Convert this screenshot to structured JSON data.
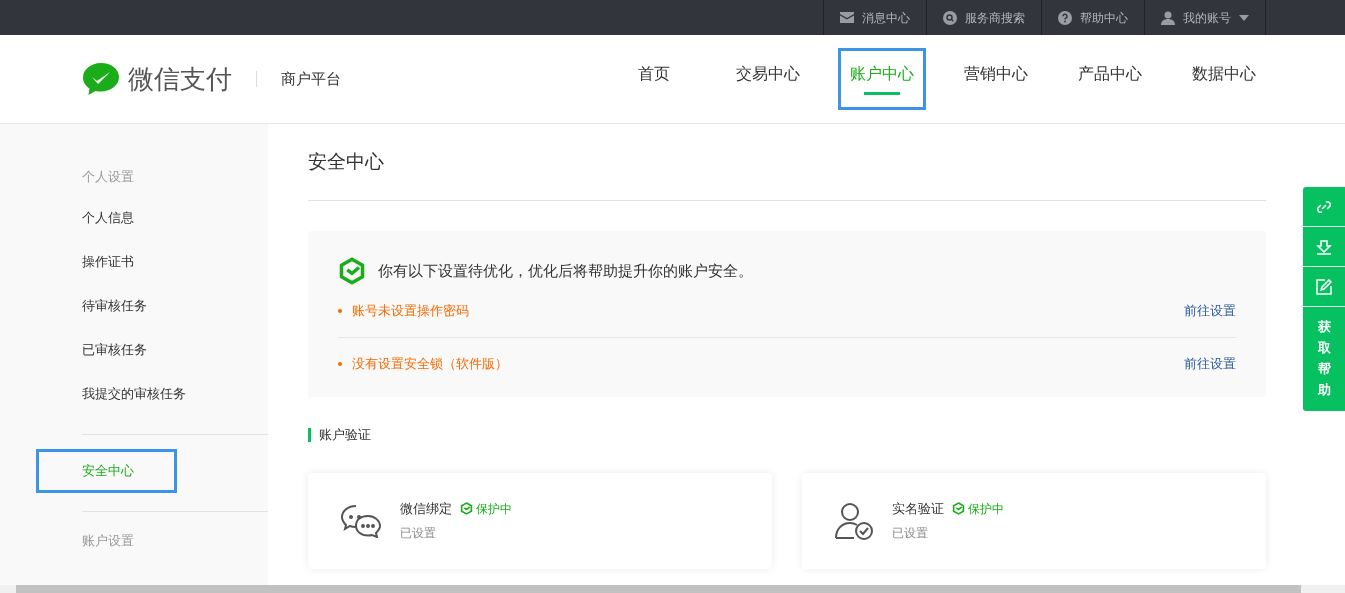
{
  "top_bar": {
    "links": [
      {
        "kind": "mail",
        "label": "消息中心"
      },
      {
        "kind": "search",
        "label": "服务商搜索"
      },
      {
        "kind": "help",
        "label": "帮助中心"
      },
      {
        "kind": "user",
        "label": "我的账号",
        "dropdown": true
      }
    ]
  },
  "header": {
    "brand": "微信支付",
    "subtitle": "商户平台",
    "nav": [
      {
        "label": "首页",
        "selected": false,
        "highlighted": false
      },
      {
        "label": "交易中心",
        "selected": false,
        "highlighted": false
      },
      {
        "label": "账户中心",
        "selected": true,
        "highlighted": true
      },
      {
        "label": "营销中心",
        "selected": false,
        "highlighted": false
      },
      {
        "label": "产品中心",
        "selected": false,
        "highlighted": false
      },
      {
        "label": "数据中心",
        "selected": false,
        "highlighted": false
      }
    ]
  },
  "sidebar": {
    "groups": [
      {
        "title": "个人设置",
        "items": [
          {
            "label": "个人信息",
            "selected": false,
            "highlighted": false
          },
          {
            "label": "操作证书",
            "selected": false,
            "highlighted": false
          },
          {
            "label": "待审核任务",
            "selected": false,
            "highlighted": false
          },
          {
            "label": "已审核任务",
            "selected": false,
            "highlighted": false
          },
          {
            "label": "我提交的审核任务",
            "selected": false,
            "highlighted": false
          }
        ]
      },
      {
        "items": [
          {
            "label": "安全中心",
            "selected": true,
            "highlighted": true
          }
        ]
      },
      {
        "title": "账户设置"
      }
    ]
  },
  "main": {
    "title": "安全中心",
    "notice": {
      "message": "你有以下设置待优化，优化后将帮助提升你的账户安全。",
      "items": [
        {
          "text": "账号未设置操作密码",
          "action": "前往设置"
        },
        {
          "text": "没有设置安全锁（软件版）",
          "action": "前往设置"
        }
      ]
    },
    "section_title": "账户验证",
    "cards": [
      {
        "kind": "chat",
        "title": "微信绑定",
        "badge": "保护中",
        "status": "已设置"
      },
      {
        "kind": "person",
        "title": "实名验证",
        "badge": "保护中",
        "status": "已设置"
      }
    ]
  },
  "float_toolbar": {
    "buttons": [
      {
        "kind": "link"
      },
      {
        "kind": "download"
      },
      {
        "kind": "edit"
      },
      {
        "kind": "text",
        "label": "获取帮助"
      }
    ]
  }
}
